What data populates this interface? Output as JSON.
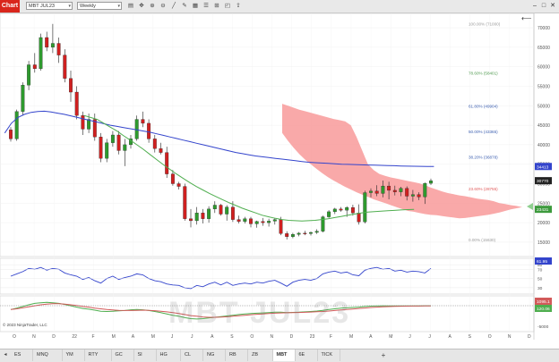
{
  "toolbar": {
    "chart_label": "Chart",
    "instrument": "MBT JUL23",
    "interval": "Weekly",
    "icons": [
      "instrument-lookup-icon",
      "crosshair-icon",
      "zoom-in-icon",
      "zoom-out-icon",
      "draw-line-icon",
      "drawing-tools-icon",
      "templates-icon",
      "properties-icon",
      "attach-icon",
      "screenshot-icon",
      "share-icon"
    ],
    "window_buttons": [
      "minimize",
      "maximize",
      "close"
    ]
  },
  "price_axis": {
    "ticks": [
      "70000",
      "65000",
      "60000",
      "55000",
      "50000",
      "45000",
      "40000",
      "35000",
      "30000",
      "25000",
      "20000",
      "15000"
    ],
    "last_price": "30770",
    "ma_blue": "34413",
    "ma_green": "23431",
    "fib_levels": [
      {
        "label": "100.00% (71000)",
        "value": 71000,
        "color": "#9a9a9a"
      },
      {
        "label": "78.60% (58401)",
        "value": 58401,
        "color": "#4f9a4f"
      },
      {
        "label": "61.80% (49904)",
        "value": 49904,
        "color": "#3c5fb0"
      },
      {
        "label": "50.00% (43365)",
        "value": 43365,
        "color": "#3c5fb0"
      },
      {
        "label": "38.20% (36878)",
        "value": 36878,
        "color": "#3c5fb0"
      },
      {
        "label": "23.60% (28755)",
        "value": 28755,
        "color": "#e05a5a"
      },
      {
        "label": "0.00% (15630)",
        "value": 15630,
        "color": "#9a9a9a"
      }
    ]
  },
  "rsi_axis": {
    "ticks": [
      "80",
      "70",
      "50",
      "30"
    ],
    "last": "61.95"
  },
  "macd_axis": {
    "ticks": [
      "-5000"
    ],
    "last1": "1095.1",
    "last2": "120.06"
  },
  "time_axis": [
    "O",
    "N",
    "D",
    "22",
    "F",
    "M",
    "A",
    "M",
    "J",
    "J",
    "A",
    "S",
    "O",
    "N",
    "D",
    "23",
    "F",
    "M",
    "A",
    "M",
    "J",
    "J",
    "A",
    "S",
    "O",
    "N",
    "D"
  ],
  "watermark": "MBT JUL23",
  "copyright": "© 2023 NinjaTrader, LLC",
  "tabs": [
    {
      "label": "ES",
      "active": false
    },
    {
      "label": "MNQ",
      "active": false
    },
    {
      "label": "YM",
      "active": false
    },
    {
      "label": "RTY",
      "active": false
    },
    {
      "label": "GC",
      "active": false
    },
    {
      "label": "SI",
      "active": false
    },
    {
      "label": "HG",
      "active": false
    },
    {
      "label": "CL",
      "active": false
    },
    {
      "label": "NG",
      "active": false
    },
    {
      "label": "RB",
      "active": false
    },
    {
      "label": "ZB",
      "active": false
    },
    {
      "label": "MBT",
      "active": true
    },
    {
      "label": "6E",
      "active": false
    },
    {
      "label": "TICK",
      "active": false
    }
  ],
  "chart_data": {
    "type": "candlestick",
    "instrument": "MBT JUL23",
    "interval": "Weekly",
    "candles": [
      [
        43800,
        44500,
        40800,
        41500
      ],
      [
        41500,
        49000,
        41000,
        48500
      ],
      [
        48500,
        56000,
        47500,
        55300
      ],
      [
        55300,
        61500,
        54000,
        60500
      ],
      [
        60500,
        63500,
        58500,
        59500
      ],
      [
        59500,
        68500,
        59000,
        67500
      ],
      [
        67500,
        69000,
        64000,
        65000
      ],
      [
        65000,
        71000,
        63500,
        66000
      ],
      [
        66000,
        67500,
        61000,
        63000
      ],
      [
        63000,
        64500,
        56000,
        57000
      ],
      [
        57000,
        59000,
        51000,
        53500
      ],
      [
        53500,
        55000,
        46500,
        47500
      ],
      [
        47500,
        48500,
        42500,
        44000
      ],
      [
        44000,
        48000,
        43000,
        46500
      ],
      [
        46500,
        48000,
        41000,
        42000
      ],
      [
        42000,
        43000,
        35500,
        36500
      ],
      [
        36500,
        41500,
        35500,
        40500
      ],
      [
        40500,
        43500,
        39500,
        42500
      ],
      [
        42500,
        43500,
        37500,
        38500
      ],
      [
        38500,
        41500,
        34500,
        40000
      ],
      [
        40000,
        42500,
        39000,
        41500
      ],
      [
        41500,
        47500,
        41000,
        46500
      ],
      [
        46500,
        48500,
        44500,
        45500
      ],
      [
        45500,
        46500,
        40500,
        41500
      ],
      [
        41500,
        42500,
        38000,
        39000
      ],
      [
        39000,
        40500,
        37500,
        38000
      ],
      [
        38000,
        39500,
        31500,
        32500
      ],
      [
        32500,
        33500,
        29500,
        30000
      ],
      [
        30000,
        30500,
        28500,
        29300
      ],
      [
        29300,
        30000,
        20500,
        21000
      ],
      [
        21000,
        23500,
        18800,
        20500
      ],
      [
        20500,
        24000,
        19500,
        22500
      ],
      [
        22500,
        23500,
        19800,
        21000
      ],
      [
        21000,
        24200,
        20000,
        23500
      ],
      [
        23500,
        25500,
        22500,
        24500
      ],
      [
        24500,
        24800,
        21800,
        22200
      ],
      [
        22200,
        24500,
        20500,
        24000
      ],
      [
        24000,
        25500,
        20200,
        20800
      ],
      [
        20800,
        21800,
        19800,
        20300
      ],
      [
        20300,
        21500,
        19800,
        21000
      ],
      [
        21000,
        21500,
        18800,
        19700
      ],
      [
        19700,
        20500,
        18700,
        20300
      ],
      [
        20300,
        21200,
        19200,
        20000
      ],
      [
        20000,
        21000,
        19000,
        20400
      ],
      [
        20400,
        21200,
        19500,
        20800
      ],
      [
        20800,
        21500,
        16800,
        17200
      ],
      [
        17200,
        17800,
        15700,
        16400
      ],
      [
        16400,
        17400,
        16000,
        17000
      ],
      [
        17000,
        17600,
        16500,
        17300
      ],
      [
        17300,
        17900,
        16800,
        17200
      ],
      [
        17200,
        17700,
        16700,
        17500
      ],
      [
        17500,
        18300,
        17100,
        17800
      ],
      [
        17800,
        21800,
        17500,
        21500
      ],
      [
        21500,
        23200,
        21200,
        22800
      ],
      [
        22800,
        23800,
        22200,
        23500
      ],
      [
        23500,
        24000,
        22800,
        23200
      ],
      [
        23200,
        24200,
        21500,
        23900
      ],
      [
        23900,
        24600,
        21800,
        22500
      ],
      [
        22500,
        24700,
        19500,
        20200
      ],
      [
        20200,
        28200,
        19800,
        27700
      ],
      [
        27700,
        28800,
        26500,
        28100
      ],
      [
        28100,
        29600,
        26800,
        27500
      ],
      [
        27500,
        30800,
        26500,
        29400
      ],
      [
        29400,
        30500,
        26000,
        28300
      ],
      [
        28300,
        29500,
        27000,
        27900
      ],
      [
        27900,
        29200,
        26800,
        28800
      ],
      [
        28800,
        29300,
        25700,
        26800
      ],
      [
        26800,
        28400,
        25400,
        27200
      ],
      [
        27200,
        27800,
        25800,
        26600
      ],
      [
        26600,
        30300,
        24800,
        30100
      ],
      [
        30100,
        31300,
        29700,
        30770
      ]
    ],
    "series": [
      {
        "name": "blue_ma",
        "color": "#3344cc",
        "values": [
          43000,
          45500,
          47000,
          47800,
          48300,
          48500,
          48600,
          48400,
          48100,
          47800,
          47400,
          47000,
          46600,
          46200,
          45800,
          45400,
          45000,
          44700,
          44400,
          44100,
          43800,
          43500,
          43200,
          42800,
          42400,
          42000,
          41600,
          41200,
          40800,
          40400,
          40000,
          39600,
          39200,
          38800,
          38400,
          38000,
          37700,
          37400,
          37100,
          36900,
          36700,
          36500,
          36300,
          36100,
          35900,
          35700,
          35500,
          35400,
          35300,
          35200,
          35100,
          35000,
          34950,
          34900,
          34850,
          34800,
          34750,
          34700,
          34650,
          34600,
          34550,
          34500,
          34470,
          34440,
          34420,
          34413
        ]
      },
      {
        "name": "green_ma",
        "color": "#4fae4f",
        "values": [
          null,
          null,
          null,
          null,
          null,
          null,
          null,
          null,
          null,
          null,
          null,
          null,
          47500,
          47000,
          46500,
          45500,
          44500,
          43500,
          42300,
          41200,
          40000,
          38800,
          37500,
          36200,
          34900,
          33700,
          32500,
          31400,
          30300,
          29300,
          28400,
          27500,
          26700,
          25900,
          25100,
          24400,
          23700,
          23100,
          22500,
          21900,
          21500,
          21100,
          20800,
          20600,
          20500,
          20450,
          20500,
          20600,
          20800,
          21000,
          21300,
          21600,
          21900,
          22200,
          22500,
          22700,
          22850,
          22950,
          23050,
          23150,
          23250,
          23350,
          23431
        ]
      }
    ],
    "cloud": {
      "color": "#f8a0a0",
      "upper": [
        50500,
        50000,
        49500,
        49000,
        48600,
        48200,
        47800,
        47400,
        47000,
        46600,
        46300,
        46000,
        45000,
        42000,
        38500,
        35000,
        33500,
        32500,
        32000,
        31600,
        31300,
        31000,
        30700,
        30400,
        30100,
        29600,
        29000,
        28500,
        28000,
        27600,
        27300,
        27000,
        26800,
        26500,
        26200,
        26000,
        25800,
        25500,
        25000,
        24800,
        24500,
        24300,
        24000
      ],
      "lower": [
        43000,
        41000,
        39200,
        37600,
        36200,
        35000,
        33800,
        32700,
        31700,
        30800,
        30000,
        29200,
        28500,
        27800,
        27200,
        26600,
        26000,
        25500,
        25000,
        24500,
        24000,
        23500,
        23000,
        22800,
        22500,
        22200,
        22000,
        21900,
        21700,
        21500,
        21300,
        21100,
        21200,
        21400,
        21600,
        21800,
        22000,
        22300,
        22600,
        23000,
        23400,
        23700,
        24000
      ]
    },
    "rsi": {
      "values": [
        55,
        60,
        65,
        72,
        70,
        74,
        68,
        72,
        70,
        62,
        58,
        55,
        48,
        52,
        45,
        40,
        50,
        55,
        48,
        52,
        55,
        60,
        58,
        50,
        45,
        43,
        38,
        36,
        35,
        30,
        28,
        35,
        32,
        38,
        42,
        36,
        42,
        35,
        38,
        40,
        38,
        42,
        40,
        44,
        46,
        40,
        33,
        42,
        46,
        48,
        46,
        50,
        60,
        64,
        66,
        62,
        64,
        58,
        56,
        68,
        72,
        74,
        70,
        72,
        66,
        68,
        64,
        66,
        65,
        62,
        72
      ],
      "ylim": [
        20,
        90
      ]
    },
    "macd": {
      "macd_line": [
        0,
        400,
        900,
        1400,
        1800,
        2000,
        2100,
        2000,
        1800,
        1500,
        1100,
        700,
        300,
        100,
        -200,
        -500,
        -600,
        -500,
        -400,
        -300,
        -100,
        0,
        -100,
        -300,
        -600,
        -900,
        -1300,
        -1700,
        -2000,
        -2400,
        -2700,
        -2800,
        -2700,
        -2500,
        -2300,
        -2100,
        -1900,
        -1700,
        -1500,
        -1300,
        -1200,
        -1100,
        -1000,
        -900,
        -800,
        -800,
        -900,
        -850,
        -800,
        -700,
        -600,
        -450,
        -250,
        0,
        200,
        400,
        500,
        600,
        700,
        900,
        1000,
        1050,
        1100,
        1080,
        1060,
        1050,
        1040,
        1050,
        1070,
        1090,
        1095
      ],
      "signal_line": [
        0,
        200,
        500,
        800,
        1100,
        1400,
        1600,
        1700,
        1700,
        1600,
        1400,
        1200,
        900,
        700,
        400,
        200,
        0,
        -150,
        -250,
        -300,
        -300,
        -250,
        -200,
        -250,
        -350,
        -500,
        -700,
        -900,
        -1200,
        -1500,
        -1800,
        -2000,
        -2200,
        -2300,
        -2300,
        -2250,
        -2150,
        -2000,
        -1850,
        -1700,
        -1550,
        -1400,
        -1300,
        -1200,
        -1100,
        -1000,
        -950,
        -900,
        -870,
        -820,
        -760,
        -680,
        -580,
        -450,
        -300,
        -150,
        0,
        150,
        300,
        450,
        600,
        700,
        800,
        870,
        920,
        960,
        990,
        1010,
        1030,
        1050,
        1060
      ],
      "ylim": [
        -6000,
        3500
      ]
    }
  }
}
